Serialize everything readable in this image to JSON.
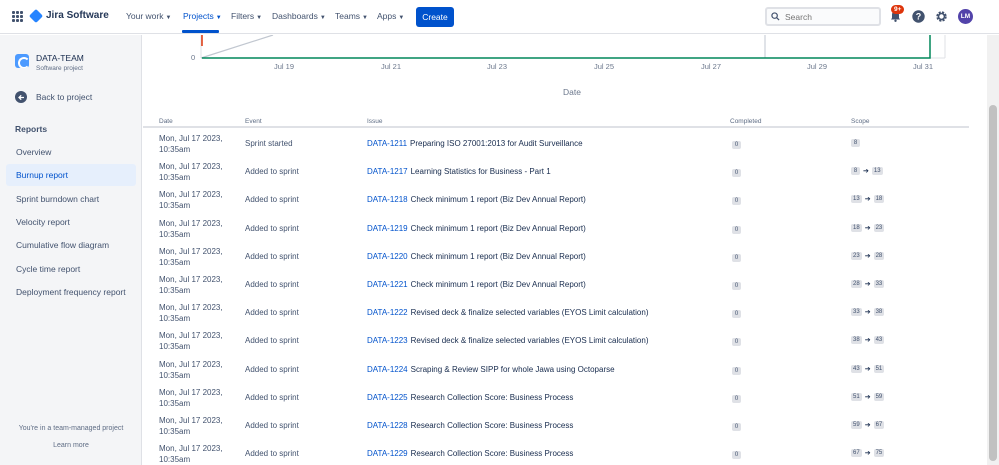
{
  "nav": {
    "app_name": "Jira Software",
    "items": [
      {
        "label": "Your work"
      },
      {
        "label": "Projects"
      },
      {
        "label": "Filters"
      },
      {
        "label": "Dashboards"
      },
      {
        "label": "Teams"
      },
      {
        "label": "Apps"
      }
    ],
    "create_label": "Create",
    "search_placeholder": "Search",
    "notifications_badge": "9+",
    "avatar_initials": "LM"
  },
  "sidebar": {
    "project_name": "DATA-TEAM",
    "project_type": "Software project",
    "back_label": "Back to project",
    "section_label": "Reports",
    "items": [
      {
        "label": "Overview"
      },
      {
        "label": "Burnup report"
      },
      {
        "label": "Sprint burndown chart"
      },
      {
        "label": "Velocity report"
      },
      {
        "label": "Cumulative flow diagram"
      },
      {
        "label": "Cycle time report"
      },
      {
        "label": "Deployment frequency report"
      }
    ],
    "footer_note": "You're in a team-managed project",
    "learn_more": "Learn more"
  },
  "chart_data": {
    "type": "line",
    "xlabel": "Date",
    "ylabel": "",
    "y_tick_visible": "0",
    "x_ticks": [
      "Jul 19",
      "Jul 21",
      "Jul 23",
      "Jul 25",
      "Jul 27",
      "Jul 29",
      "Jul 31"
    ],
    "colors": {
      "guideline": "#c1c7d0",
      "completed": "#00875a",
      "scope_marker": "#de350b",
      "axis": "#dfe1e6"
    }
  },
  "table": {
    "headers": {
      "date": "Date",
      "event": "Event",
      "issue": "Issue",
      "completed": "Completed",
      "scope": "Scope"
    },
    "rows": [
      {
        "date": "Mon, Jul 17 2023, 10:35am",
        "event": "Sprint started",
        "key": "DATA-1211",
        "summary": "Preparing ISO 27001:2013 for Audit Surveillance",
        "completed": "0",
        "scope_from": "8",
        "scope_to": ""
      },
      {
        "date": "Mon, Jul 17 2023, 10:35am",
        "event": "Added to sprint",
        "key": "DATA-1217",
        "summary": "Learning Statistics for Business - Part 1",
        "completed": "0",
        "scope_from": "8",
        "scope_to": "13"
      },
      {
        "date": "Mon, Jul 17 2023, 10:35am",
        "event": "Added to sprint",
        "key": "DATA-1218",
        "summary": "Check minimum 1 report (Biz Dev Annual Report)",
        "completed": "0",
        "scope_from": "13",
        "scope_to": "18"
      },
      {
        "date": "Mon, Jul 17 2023, 10:35am",
        "event": "Added to sprint",
        "key": "DATA-1219",
        "summary": "Check minimum 1 report (Biz Dev Annual Report)",
        "completed": "0",
        "scope_from": "18",
        "scope_to": "23"
      },
      {
        "date": "Mon, Jul 17 2023, 10:35am",
        "event": "Added to sprint",
        "key": "DATA-1220",
        "summary": "Check minimum 1 report (Biz Dev Annual Report)",
        "completed": "0",
        "scope_from": "23",
        "scope_to": "28"
      },
      {
        "date": "Mon, Jul 17 2023, 10:35am",
        "event": "Added to sprint",
        "key": "DATA-1221",
        "summary": "Check minimum 1 report (Biz Dev Annual Report)",
        "completed": "0",
        "scope_from": "28",
        "scope_to": "33"
      },
      {
        "date": "Mon, Jul 17 2023, 10:35am",
        "event": "Added to sprint",
        "key": "DATA-1222",
        "summary": "Revised deck & finalize selected variables (EYOS Limit calculation)",
        "completed": "0",
        "scope_from": "33",
        "scope_to": "38"
      },
      {
        "date": "Mon, Jul 17 2023, 10:35am",
        "event": "Added to sprint",
        "key": "DATA-1223",
        "summary": "Revised deck & finalize selected variables (EYOS Limit calculation)",
        "completed": "0",
        "scope_from": "38",
        "scope_to": "43"
      },
      {
        "date": "Mon, Jul 17 2023, 10:35am",
        "event": "Added to sprint",
        "key": "DATA-1224",
        "summary": "Scraping & Review SIPP for whole Jawa using Octoparse",
        "completed": "0",
        "scope_from": "43",
        "scope_to": "51"
      },
      {
        "date": "Mon, Jul 17 2023, 10:35am",
        "event": "Added to sprint",
        "key": "DATA-1225",
        "summary": "Research Collection Score: Business Process",
        "completed": "0",
        "scope_from": "51",
        "scope_to": "59"
      },
      {
        "date": "Mon, Jul 17 2023, 10:35am",
        "event": "Added to sprint",
        "key": "DATA-1228",
        "summary": "Research Collection Score: Business Process",
        "completed": "0",
        "scope_from": "59",
        "scope_to": "67"
      },
      {
        "date": "Mon, Jul 17 2023, 10:35am",
        "event": "Added to sprint",
        "key": "DATA-1229",
        "summary": "Research Collection Score: Business Process",
        "completed": "0",
        "scope_from": "67",
        "scope_to": "75"
      }
    ]
  }
}
